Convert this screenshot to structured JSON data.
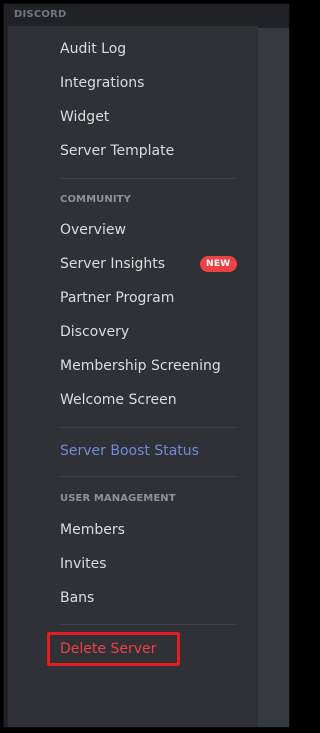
{
  "app": {
    "brand": "DISCORD"
  },
  "sidebar": {
    "items_top": [
      {
        "label": "Audit Log"
      },
      {
        "label": "Integrations"
      },
      {
        "label": "Widget"
      },
      {
        "label": "Server Template"
      }
    ],
    "community": {
      "header": "COMMUNITY",
      "items": [
        {
          "label": "Overview"
        },
        {
          "label": "Server Insights",
          "badge": "NEW"
        },
        {
          "label": "Partner Program"
        },
        {
          "label": "Discovery"
        },
        {
          "label": "Membership Screening"
        },
        {
          "label": "Welcome Screen"
        }
      ]
    },
    "boost": {
      "label": "Server Boost Status"
    },
    "user_management": {
      "header": "USER MANAGEMENT",
      "items": [
        {
          "label": "Members"
        },
        {
          "label": "Invites"
        },
        {
          "label": "Bans"
        }
      ]
    },
    "danger": {
      "label": "Delete Server"
    }
  },
  "colors": {
    "background": "#2f3136",
    "text": "#dcddde",
    "header": "#8e9297",
    "boost": "#7289da",
    "danger": "#ed4245",
    "badge": "#ed4245",
    "highlight": "#e02020"
  }
}
